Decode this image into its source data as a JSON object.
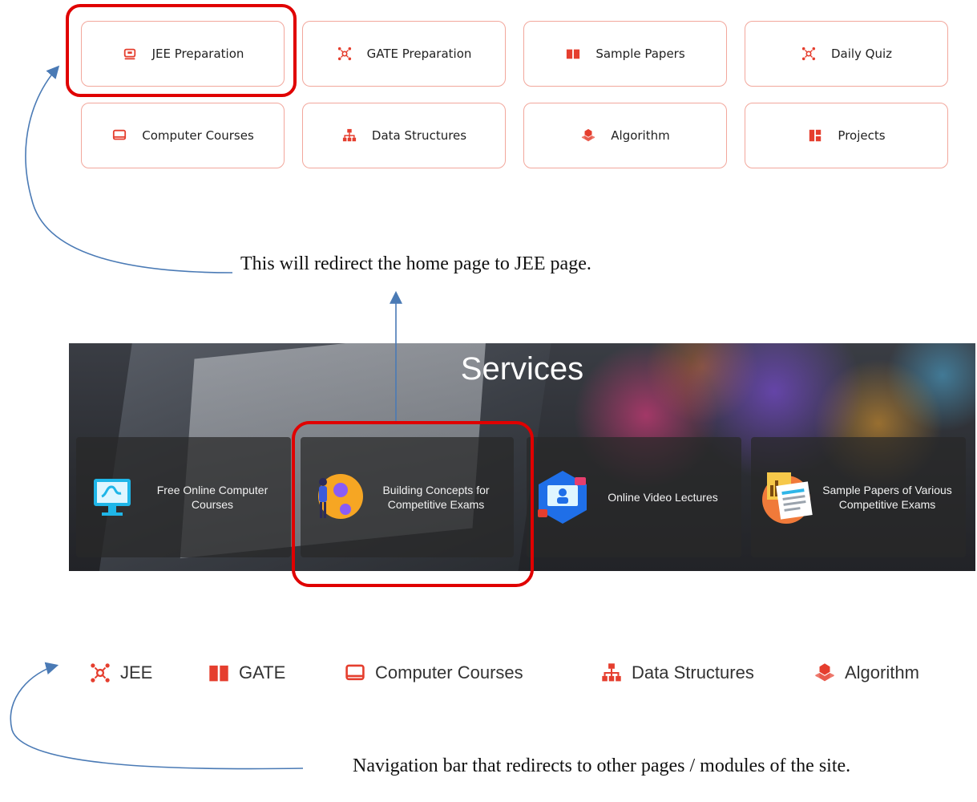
{
  "colors": {
    "accent": "#e53e2e",
    "card_border": "#f2a79c",
    "highlight": "#e00000",
    "arrow": "#4a7ab5"
  },
  "cards": [
    {
      "label": "JEE Preparation",
      "icon": "robot-icon"
    },
    {
      "label": "GATE Preparation",
      "icon": "network-icon"
    },
    {
      "label": "Sample Papers",
      "icon": "book-icon"
    },
    {
      "label": "Daily Quiz",
      "icon": "network-icon"
    },
    {
      "label": "Computer Courses",
      "icon": "laptop-icon"
    },
    {
      "label": "Data Structures",
      "icon": "sitemap-icon"
    },
    {
      "label": "Algorithm",
      "icon": "cubes-icon"
    },
    {
      "label": "Projects",
      "icon": "layout-icon"
    }
  ],
  "annotations": {
    "card_note": "This will redirect the home page to JEE page.",
    "nav_note": "Navigation bar that redirects to other pages / modules of the site."
  },
  "services": {
    "title": "Services",
    "items": [
      {
        "label": "Free Online Computer Courses",
        "icon": "monitor-icon"
      },
      {
        "label": "Building Concepts for Competitive Exams",
        "icon": "person-icon"
      },
      {
        "label": "Online Video Lectures",
        "icon": "video-icon"
      },
      {
        "label": "Sample Papers of Various Competitive Exams",
        "icon": "document-icon"
      }
    ]
  },
  "nav": [
    {
      "label": "JEE",
      "icon": "network-icon"
    },
    {
      "label": "GATE",
      "icon": "book-icon"
    },
    {
      "label": "Computer Courses",
      "icon": "laptop-icon"
    },
    {
      "label": "Data Structures",
      "icon": "sitemap-icon"
    },
    {
      "label": "Algorithm",
      "icon": "cubes-icon"
    }
  ]
}
